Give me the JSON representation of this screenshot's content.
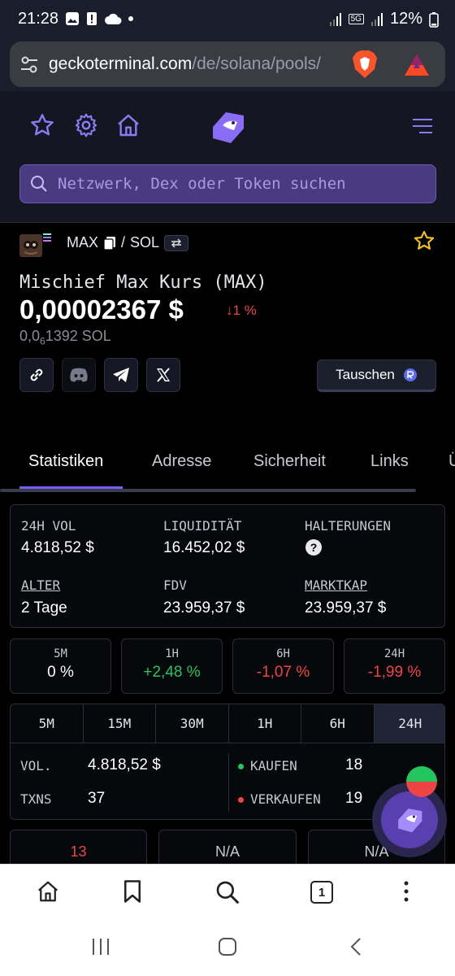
{
  "status_bar": {
    "time": "21:28",
    "battery": "12%",
    "network": "5G"
  },
  "browser": {
    "url_domain": "geckoterminal.com",
    "url_path": "/de/solana/pools/",
    "tab_count": "1"
  },
  "header": {
    "search_placeholder": "Netzwerk, Dex oder Token suchen"
  },
  "token": {
    "symbol": "MAX",
    "quote": "SOL",
    "separator": "/",
    "title": "Mischief Max Kurs (MAX)",
    "price_usd": "0,00002367 $",
    "change": "↓1 %",
    "price_sol_prefix": "0,0",
    "price_sol_sub": "6",
    "price_sol_rest": "1392 SOL",
    "swap_label": "Tauschen"
  },
  "tabs": [
    "Statistiken",
    "Adresse",
    "Sicherheit",
    "Links",
    "Ü"
  ],
  "stats": {
    "vol_label": "24H VOL",
    "vol_value": "4.818,52 $",
    "liq_label": "LIQUIDITÄT",
    "liq_value": "16.452,02 $",
    "holders_label": "HALTERUNGEN",
    "holders_value": "?",
    "age_label": "ALTER",
    "age_value": "2 Tage",
    "fdv_label": "FDV",
    "fdv_value": "23.959,37 $",
    "mcap_label": "MARKTKAP",
    "mcap_value": "23.959,37 $"
  },
  "changes": [
    {
      "label": "5M",
      "value": "0 %",
      "color": "#ffffff"
    },
    {
      "label": "1H",
      "value": "+2,48 %",
      "color": "#22c55e"
    },
    {
      "label": "6H",
      "value": "-1,07 %",
      "color": "#ef4444"
    },
    {
      "label": "24H",
      "value": "-1,99 %",
      "color": "#ef4444"
    }
  ],
  "range": {
    "tabs": [
      "5M",
      "15M",
      "30M",
      "1H",
      "6H",
      "24H"
    ],
    "active": "24H",
    "vol_label": "VOL.",
    "vol_value": "4.818,52 $",
    "txns_label": "TXNS",
    "txns_value": "37",
    "buy_label": "KAUFEN",
    "buy_value": "18",
    "sell_label": "VERKAUFEN",
    "sell_value": "19"
  },
  "bottom_cards": [
    "13",
    "N/A",
    "N/A"
  ],
  "colors": {
    "accent": "#7c5cf5",
    "up": "#22c55e",
    "down": "#ef4444"
  }
}
